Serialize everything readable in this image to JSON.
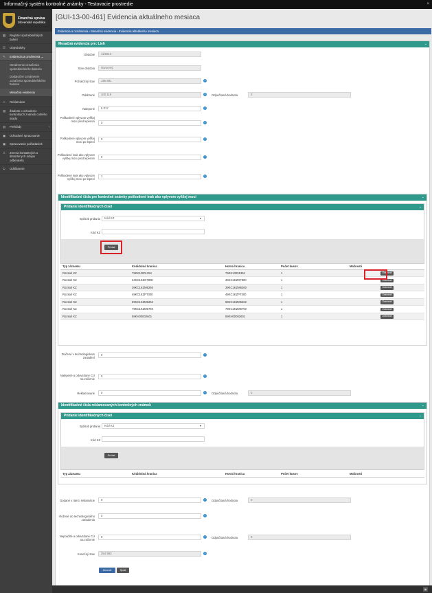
{
  "window": {
    "title": "Informačný systém kontrolné známky - Testovacie prostredie",
    "close_glyph": "×"
  },
  "logo": {
    "line1": "Finančná správa",
    "line2": "Slovenská republika"
  },
  "sidebar": {
    "items": [
      {
        "label": "Register spotrebiteľských balení",
        "icon": "grid-icon"
      },
      {
        "label": "Objednávky",
        "icon": "list-icon"
      },
      {
        "label": "Evidencia a oznámenia",
        "icon": "edit-icon"
      },
      {
        "label": "Oznámenie označenia spotrebiteľského balenia",
        "icon": ""
      },
      {
        "label": "Dodatočné oznámenie označenia spotrebiteľského balenia",
        "icon": ""
      },
      {
        "label": "Mesačná evidencia",
        "icon": ""
      },
      {
        "label": "Reklamácie",
        "icon": "warning-icon"
      },
      {
        "label": "Žiadosti o odvodenie kontrolných známok colného úradu",
        "icon": "doc-icon"
      },
      {
        "label": "Prehľady",
        "icon": "chart-icon"
      },
      {
        "label": "Odvodové spracovanie",
        "icon": "box-icon"
      },
      {
        "label": "Spracovanie požiadaviek",
        "icon": "box-icon"
      },
      {
        "label": "Zmena kontaktných a štatutárnych údajov odberateľa",
        "icon": "user-icon"
      },
      {
        "label": "Odhlásenie",
        "icon": "logout-icon"
      }
    ]
  },
  "page": {
    "title": "[GUI-13-00-461] Evidencia aktuálneho mesiaca",
    "breadcrumb": "Evidencia a oznámenia  ›  Mesačná evidencia  ›  Evidencia aktuálneho mesiaca"
  },
  "monthly": {
    "header": "Mesačná evidencia pre: Lieh",
    "fields": {
      "obdobie": {
        "label": "Obdobie",
        "value": "11/2013"
      },
      "stav": {
        "label": "Stav obdobia",
        "value": "Otvorený"
      },
      "pociatocny": {
        "label": "Počiatočný stav",
        "value": "156 881"
      },
      "odobrane": {
        "label": "Odobrané",
        "value": "100 119"
      },
      "odpocitana1": {
        "label": "Odpočítaná hodnota",
        "value": "0"
      },
      "nalepene": {
        "label": "Nalepené",
        "value": "5 017"
      },
      "posk1": {
        "label": "Poškodené vplyvom vyššej moci pred lepením",
        "value": "0"
      },
      "posk2": {
        "label": "Poškodené vplyvom vyššej moci po lepení",
        "value": "0"
      },
      "posk3": {
        "label": "Poškodené inak ako vplyvom vyššej moci pred lepením",
        "value": "0"
      },
      "posk4": {
        "label": "Poškodené inak ako vplyvom vyššej moci po lepení",
        "value": "1"
      }
    }
  },
  "identPoskodene": {
    "header": "Identifikačné čísla pre kontrolné známky poškodené inak ako vplyvom vyššej moci",
    "subheader": "Pridanie identifikačných čísel",
    "sposob": {
      "label": "Spôsob pridania",
      "value": "Kód KZ"
    },
    "kod": {
      "label": "Kód KZ",
      "value": ""
    },
    "add_btn": "Pridať",
    "columns": [
      "Typ záznamu",
      "Kódidolná hranica",
      "Horná hranica",
      "Počet kusov",
      "Možnosti"
    ],
    "rows": [
      [
        "Rozsah KZ",
        "79KK10001354",
        "79KK10001354",
        "1",
        "Odstrániť"
      ],
      [
        "Rozsah KZ",
        "34KC1KZG7800",
        "34KC1KZG7800",
        "1",
        "Odstrániť"
      ],
      [
        "Rozsah KZ",
        "39KC1KZM6260",
        "39KC1KZM6260",
        "1",
        "Odstrániť"
      ],
      [
        "Rozsah KZ",
        "49KC1KZPT300",
        "49KC1KZPT300",
        "1",
        "Odstrániť"
      ],
      [
        "Rozsah KZ",
        "69KC1KZM6262",
        "69KC1KZM6262",
        "1",
        "Odstrániť"
      ],
      [
        "Rozsah KZ",
        "79KC1KZM6750",
        "79KC1KZM6750",
        "1",
        "Odstrániť"
      ],
      [
        "Rozsah KZ",
        "59KH00002601",
        "59KH00002601",
        "1",
        "Odstrániť"
      ]
    ]
  },
  "middle": {
    "znicene": {
      "label": "Zničené v technologickom zariadení",
      "value": "0"
    },
    "nalepene_cu": {
      "label": "Nalepené a odovzdané CÚ na zničenie",
      "value": "0"
    },
    "reklamovane": {
      "label": "Reklamované",
      "value": "0"
    },
    "odpocitana2": {
      "label": "Odpočítaná hodnota",
      "value": "0"
    }
  },
  "identReklam": {
    "header": "Identifikačné čísla reklamovaných kontrolných známok",
    "subheader": "Pridanie identifikačných čísel",
    "sposob": {
      "label": "Spôsob pridania",
      "value": "Kód KZ"
    },
    "kod": {
      "label": "Kód KZ",
      "value": ""
    },
    "add_btn": "Pridať",
    "columns": [
      "Typ záznamu",
      "Kódidolná hranica",
      "Horná hranica",
      "Počet kusov",
      "Možnosti"
    ]
  },
  "bottom": {
    "dodane": {
      "label": "Dodané v rámci reklamácie",
      "value": "0"
    },
    "odp3": {
      "label": "Odpočítaná hodnota",
      "value": "0"
    },
    "vlozene": {
      "label": "Vložené do technologického zariadenia",
      "value": "0"
    },
    "nepouzite": {
      "label": "Nepoužité a odovzdané CÚ na zničenie",
      "value": "0"
    },
    "odp4": {
      "label": "Odpočítaná hodnota",
      "value": "0"
    },
    "konecny": {
      "label": "Konečný stav",
      "value": "254 983"
    },
    "save_btn": "Zmeniť",
    "back_btn": "Späť"
  },
  "colors": {
    "accent": "#2f9a8c",
    "brand_blue": "#3b6aa5",
    "highlight": "#d9232a"
  }
}
